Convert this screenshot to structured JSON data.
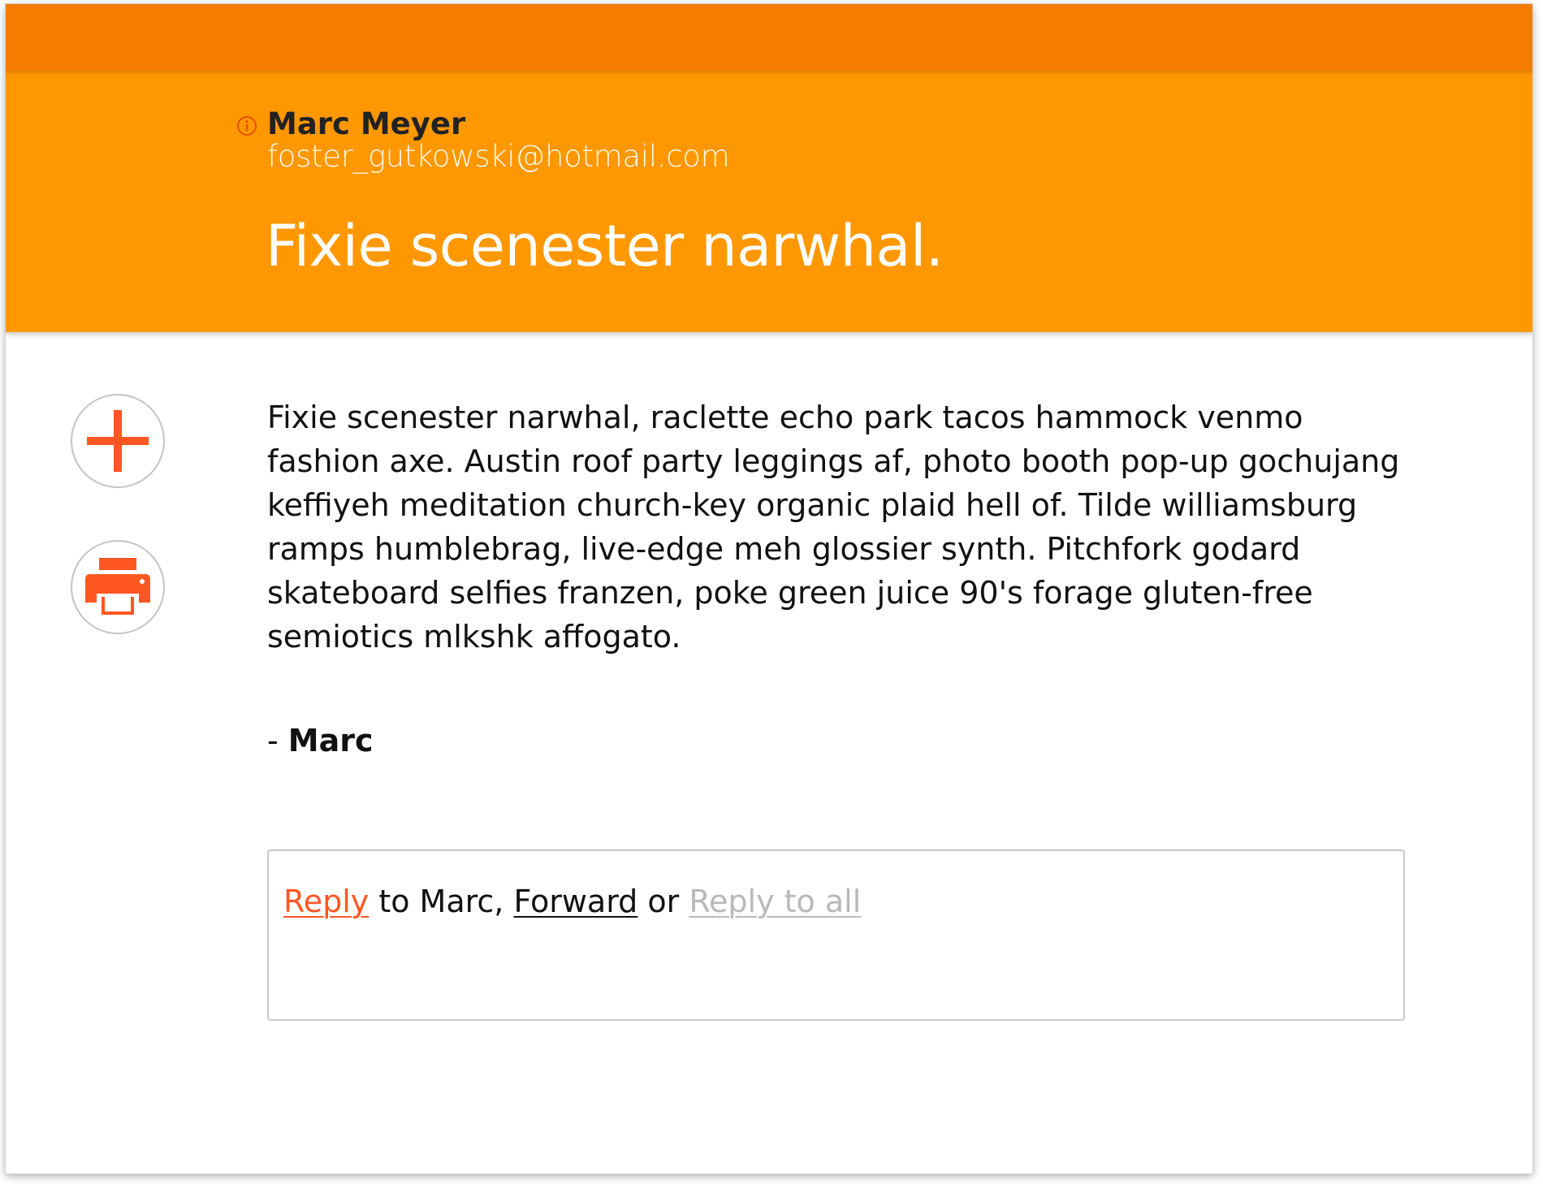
{
  "header": {
    "sender_name": "Marc Meyer",
    "sender_email": "foster_gutkowski@hotmail.com",
    "subject": "Fixie scenester narwhal.",
    "topbar_color": "#f47d00",
    "header_color": "#ff9800"
  },
  "actions": {
    "add_icon": "plus-icon",
    "print_icon": "printer-icon",
    "icon_color": "#ff5722"
  },
  "message": {
    "body": "Fixie scenester narwhal, raclette echo park tacos hammock venmo fashion axe. Austin roof party leggings af, photo booth pop-up gochujang keffiyeh meditation church-key organic plaid hell of. Tilde williamsburg ramps humblebrag, live-edge meh glossier synth. Pitchfork godard skateboard selfies franzen, poke green juice 90's forage gluten-free semiotics mlkshk affogato.",
    "signature_prefix": "- ",
    "signature_name": "Marc"
  },
  "reply": {
    "reply_label": "Reply",
    "to_text": " to Marc, ",
    "forward_label": "Forward",
    "or_text": " or ",
    "reply_all_label": "Reply to all"
  }
}
